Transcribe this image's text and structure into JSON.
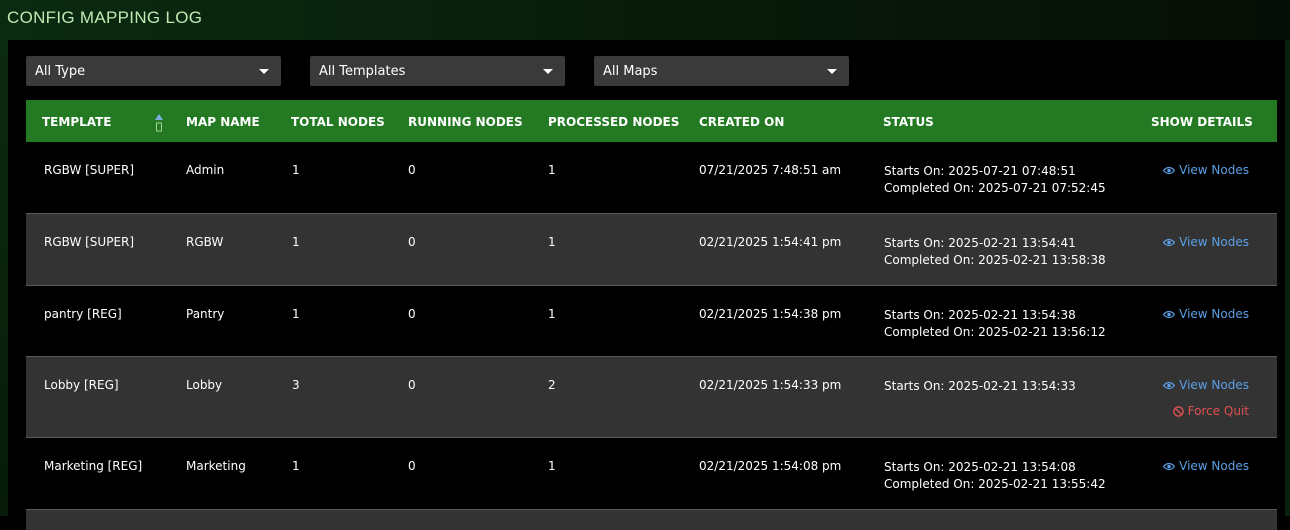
{
  "page": {
    "title": "CONFIG MAPPING LOG"
  },
  "filters": {
    "type": "All Type",
    "templates": "All Templates",
    "maps": "All Maps"
  },
  "table": {
    "headers": {
      "template": "TEMPLATE",
      "map_name": "MAP NAME",
      "total_nodes": "TOTAL NODES",
      "running_nodes": "RUNNING NODES",
      "processed_nodes": "PROCESSED NODES",
      "created_on": "CREATED ON",
      "status": "STATUS",
      "show_details": "SHOW DETAILS"
    },
    "rows": [
      {
        "template": "RGBW [SUPER]",
        "map_name": "Admin",
        "total": "1",
        "running": "0",
        "processed": "1",
        "created": "07/21/2025 7:48:51 am",
        "starts": "Starts On: 2025-07-21 07:48:51",
        "completed": "Completed On: 2025-07-21 07:52:45",
        "view": "View Nodes",
        "force": ""
      },
      {
        "template": "RGBW [SUPER]",
        "map_name": "RGBW",
        "total": "1",
        "running": "0",
        "processed": "1",
        "created": "02/21/2025 1:54:41 pm",
        "starts": "Starts On: 2025-02-21 13:54:41",
        "completed": "Completed On: 2025-02-21 13:58:38",
        "view": "View Nodes",
        "force": ""
      },
      {
        "template": "pantry [REG]",
        "map_name": "Pantry",
        "total": "1",
        "running": "0",
        "processed": "1",
        "created": "02/21/2025 1:54:38 pm",
        "starts": "Starts On: 2025-02-21 13:54:38",
        "completed": "Completed On: 2025-02-21 13:56:12",
        "view": "View Nodes",
        "force": ""
      },
      {
        "template": "Lobby [REG]",
        "map_name": "Lobby",
        "total": "3",
        "running": "0",
        "processed": "2",
        "created": "02/21/2025 1:54:33 pm",
        "starts": "Starts On: 2025-02-21 13:54:33",
        "completed": "",
        "view": "View Nodes",
        "force": "Force Quit"
      },
      {
        "template": "Marketing [REG]",
        "map_name": "Marketing",
        "total": "1",
        "running": "0",
        "processed": "1",
        "created": "02/21/2025 1:54:08 pm",
        "starts": "Starts On: 2025-02-21 13:54:08",
        "completed": "Completed On: 2025-02-21 13:55:42",
        "view": "View Nodes",
        "force": ""
      }
    ]
  },
  "colors": {
    "header_bg": "#237a22",
    "link": "#5aa0e6",
    "danger": "#e05050"
  }
}
